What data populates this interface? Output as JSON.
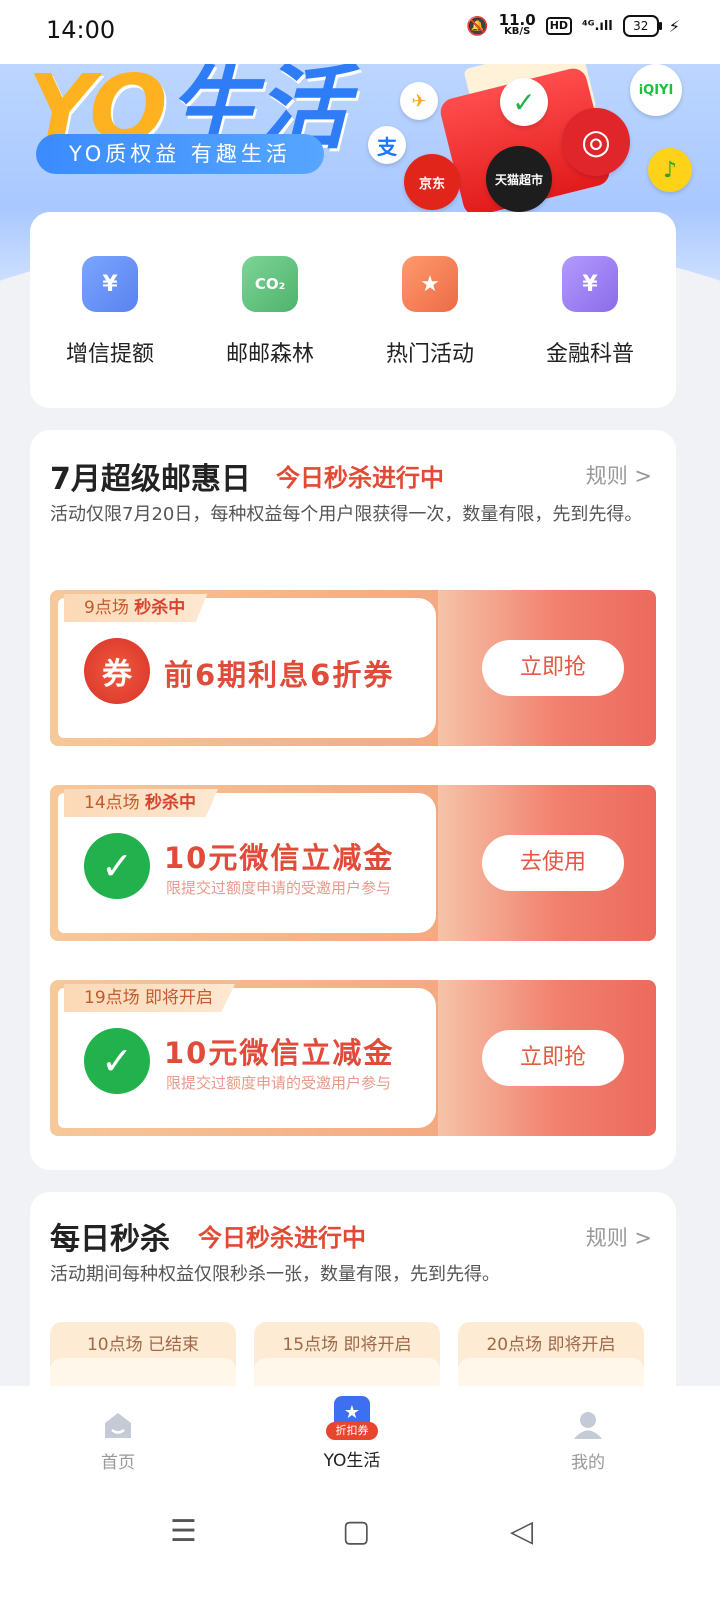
{
  "status": {
    "time": "14:00",
    "net_speed": "11.0",
    "net_unit": "KB/S",
    "hd": "HD",
    "signal": "⁴ᴳ.ıll",
    "battery": "32"
  },
  "banner": {
    "brand_yo": "YO",
    "brand_life": "生活",
    "slogan": "YO质权益 有趣生活",
    "partner_labels": [
      "支",
      "京东",
      "天猫超市",
      "iQIYI"
    ]
  },
  "quick_entries": [
    {
      "label": "增信提额",
      "icon": "wallet-icon",
      "color": "#5a8cf5"
    },
    {
      "label": "邮邮森林",
      "icon": "co2-cloud-icon",
      "color": "#5cc37a"
    },
    {
      "label": "热门活动",
      "icon": "star-bookmark-icon",
      "color": "#f07a4c"
    },
    {
      "label": "金融科普",
      "icon": "finance-doc-icon",
      "color": "#9a7cf0"
    }
  ],
  "promo": {
    "title": "7月超级邮惠日",
    "status": "今日秒杀进行中",
    "rule": "规则 >",
    "desc": "活动仅限7月20日，每种权益每个用户限获得一次，数量有限，先到先得。",
    "coupons": [
      {
        "slot": "9点场",
        "state": "秒杀中",
        "icon_text": "券",
        "title": "前6期利息6折券",
        "sub": "",
        "button": "立即抢"
      },
      {
        "slot": "14点场",
        "state": "秒杀中",
        "icon_text": "✓",
        "title": "10元微信立减金",
        "sub": "限提交过额度申请的受邀用户参与",
        "button": "去使用"
      },
      {
        "slot": "19点场",
        "state": "即将开启",
        "icon_text": "✓",
        "title": "10元微信立减金",
        "sub": "限提交过额度申请的受邀用户参与",
        "button": "立即抢"
      }
    ]
  },
  "daily": {
    "title": "每日秒杀",
    "status": "今日秒杀进行中",
    "rule": "规则 >",
    "desc": "活动期间每种权益仅限秒杀一张，数量有限，先到先得。",
    "slots": [
      "10点场 已结束",
      "15点场 即将开启",
      "20点场 即将开启"
    ]
  },
  "tabbar": {
    "home": "首页",
    "yo": "YO生活",
    "yo_badge": "折扣券",
    "mine": "我的"
  },
  "colors": {
    "accent_red": "#e24a34",
    "brand_blue": "#2f7df6",
    "brand_yellow": "#ffb21f",
    "wechat_green": "#22b14c"
  }
}
